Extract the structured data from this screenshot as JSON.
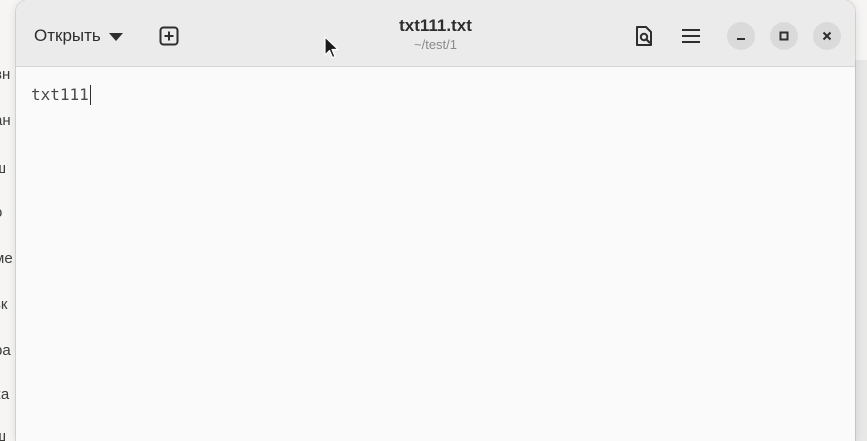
{
  "background": {
    "left_fragments": [
      "вн",
      "ан",
      "ш",
      "о",
      "ме",
      "зк",
      "ра",
      "ка",
      "ш"
    ]
  },
  "headerbar": {
    "open_label": "Открыть",
    "title": "txt111.txt",
    "subtitle": "~/test/1",
    "icons": {
      "new_tab": "new-tab-icon",
      "search_document": "document-search-icon",
      "menu": "hamburger-menu-icon",
      "minimize": "minimize-icon",
      "maximize": "maximize-icon",
      "close": "close-icon"
    }
  },
  "editor": {
    "content": "txt111"
  },
  "colors": {
    "headerbar_bg": "#ebebeb",
    "editor_bg": "#fafafa",
    "text": "#2e2e2e",
    "subtitle": "#8a8a8a",
    "window_control_bg": "#dadada"
  }
}
